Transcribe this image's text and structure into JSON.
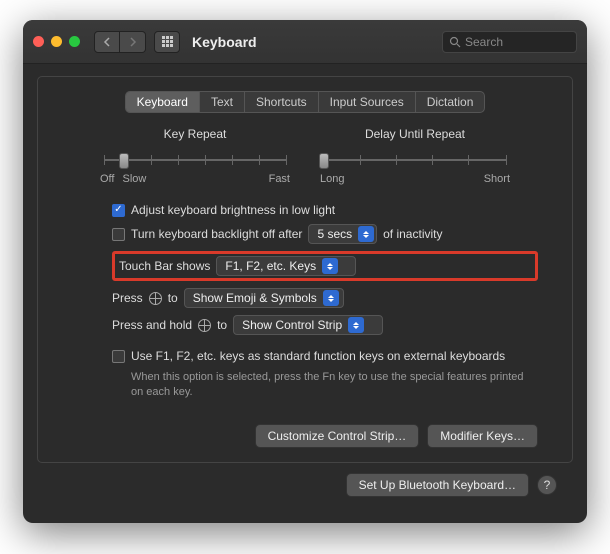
{
  "titlebar": {
    "title": "Keyboard",
    "search_placeholder": "Search"
  },
  "tabs": [
    "Keyboard",
    "Text",
    "Shortcuts",
    "Input Sources",
    "Dictation"
  ],
  "active_tab": 0,
  "sliders": {
    "key_repeat": {
      "label": "Key Repeat",
      "left": "Off",
      "left2": "Slow",
      "right": "Fast"
    },
    "delay_repeat": {
      "label": "Delay Until Repeat",
      "left": "Long",
      "right": "Short"
    }
  },
  "rows": {
    "adjust_brightness": "Adjust keyboard brightness in low light",
    "backlight_off_prefix": "Turn keyboard backlight off after",
    "backlight_off_value": "5 secs",
    "backlight_off_suffix": "of inactivity",
    "touchbar_label": "Touch Bar shows",
    "touchbar_value": "F1, F2, etc. Keys",
    "press_label": "Press",
    "press_to": "to",
    "press_value": "Show Emoji & Symbols",
    "presshold_label": "Press and hold",
    "presshold_to": "to",
    "presshold_value": "Show Control Strip",
    "fkeys_label": "Use F1, F2, etc. keys as standard function keys on external keyboards",
    "fkeys_sub": "When this option is selected, press the Fn key to use the special features printed on each key."
  },
  "buttons": {
    "customize": "Customize Control Strip…",
    "modifier": "Modifier Keys…",
    "bluetooth": "Set Up Bluetooth Keyboard…",
    "help": "?"
  }
}
